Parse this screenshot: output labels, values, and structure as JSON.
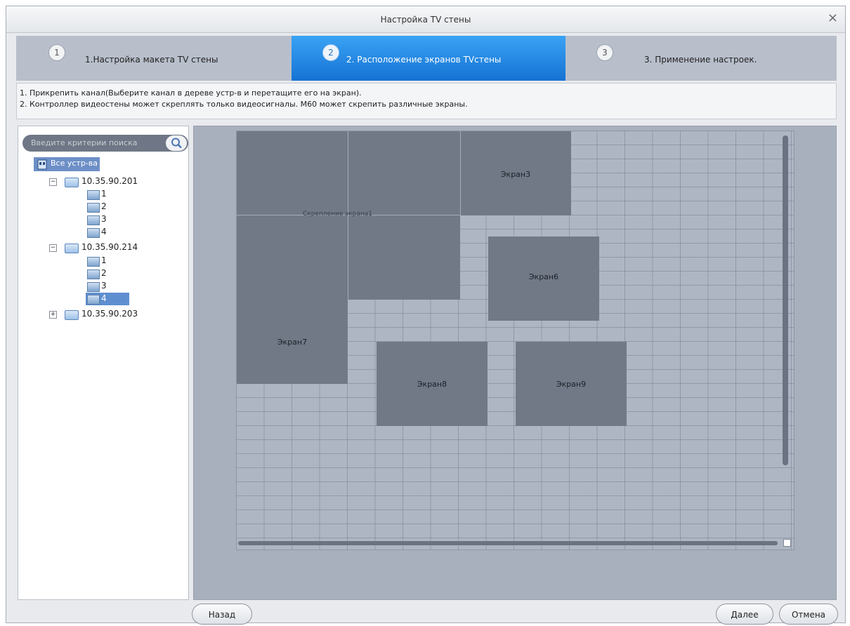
{
  "dialog": {
    "title": "Настройка TV стены",
    "close_glyph": "×"
  },
  "steps": [
    {
      "num": "1",
      "label": "1.Настройка макета TV стены",
      "active": false
    },
    {
      "num": "2",
      "label": "2. Расположение экранов TVстены",
      "active": true
    },
    {
      "num": "3",
      "label": "3. Применение настроек.",
      "active": false
    }
  ],
  "info": {
    "line1": "1. Прикрепить канал(Выберите канал в дереве устр-в и перетащите его на экран).",
    "line2": "2. Контроллер видеостены может скреплять только видеосигналы.  M60 может скрепить различные экраны."
  },
  "search": {
    "placeholder": "Введите критерии поиска",
    "icon": "search-icon"
  },
  "tree": {
    "root_label": "Все устр-ва",
    "devices": [
      {
        "ip": "10.35.90.201",
        "expanded": true,
        "expander": "−",
        "channels": [
          "1",
          "2",
          "3",
          "4"
        ]
      },
      {
        "ip": "10.35.90.214",
        "expanded": true,
        "expander": "−",
        "channels": [
          "1",
          "2",
          "3",
          "4"
        ],
        "selected_channel": "4"
      },
      {
        "ip": "10.35.90.203",
        "expanded": false,
        "expander": "+"
      }
    ]
  },
  "wall": {
    "merge_label": "Скрепление экрана1",
    "screens": [
      "Экран3",
      "Экран6",
      "Экран7",
      "Экран8",
      "Экран9"
    ]
  },
  "buttons": {
    "back": "Назад",
    "next": "Далее",
    "cancel": "Отмена"
  },
  "colors": {
    "accent": "#1572d3",
    "screen": "#717987",
    "grid": "#aeb6c3"
  }
}
